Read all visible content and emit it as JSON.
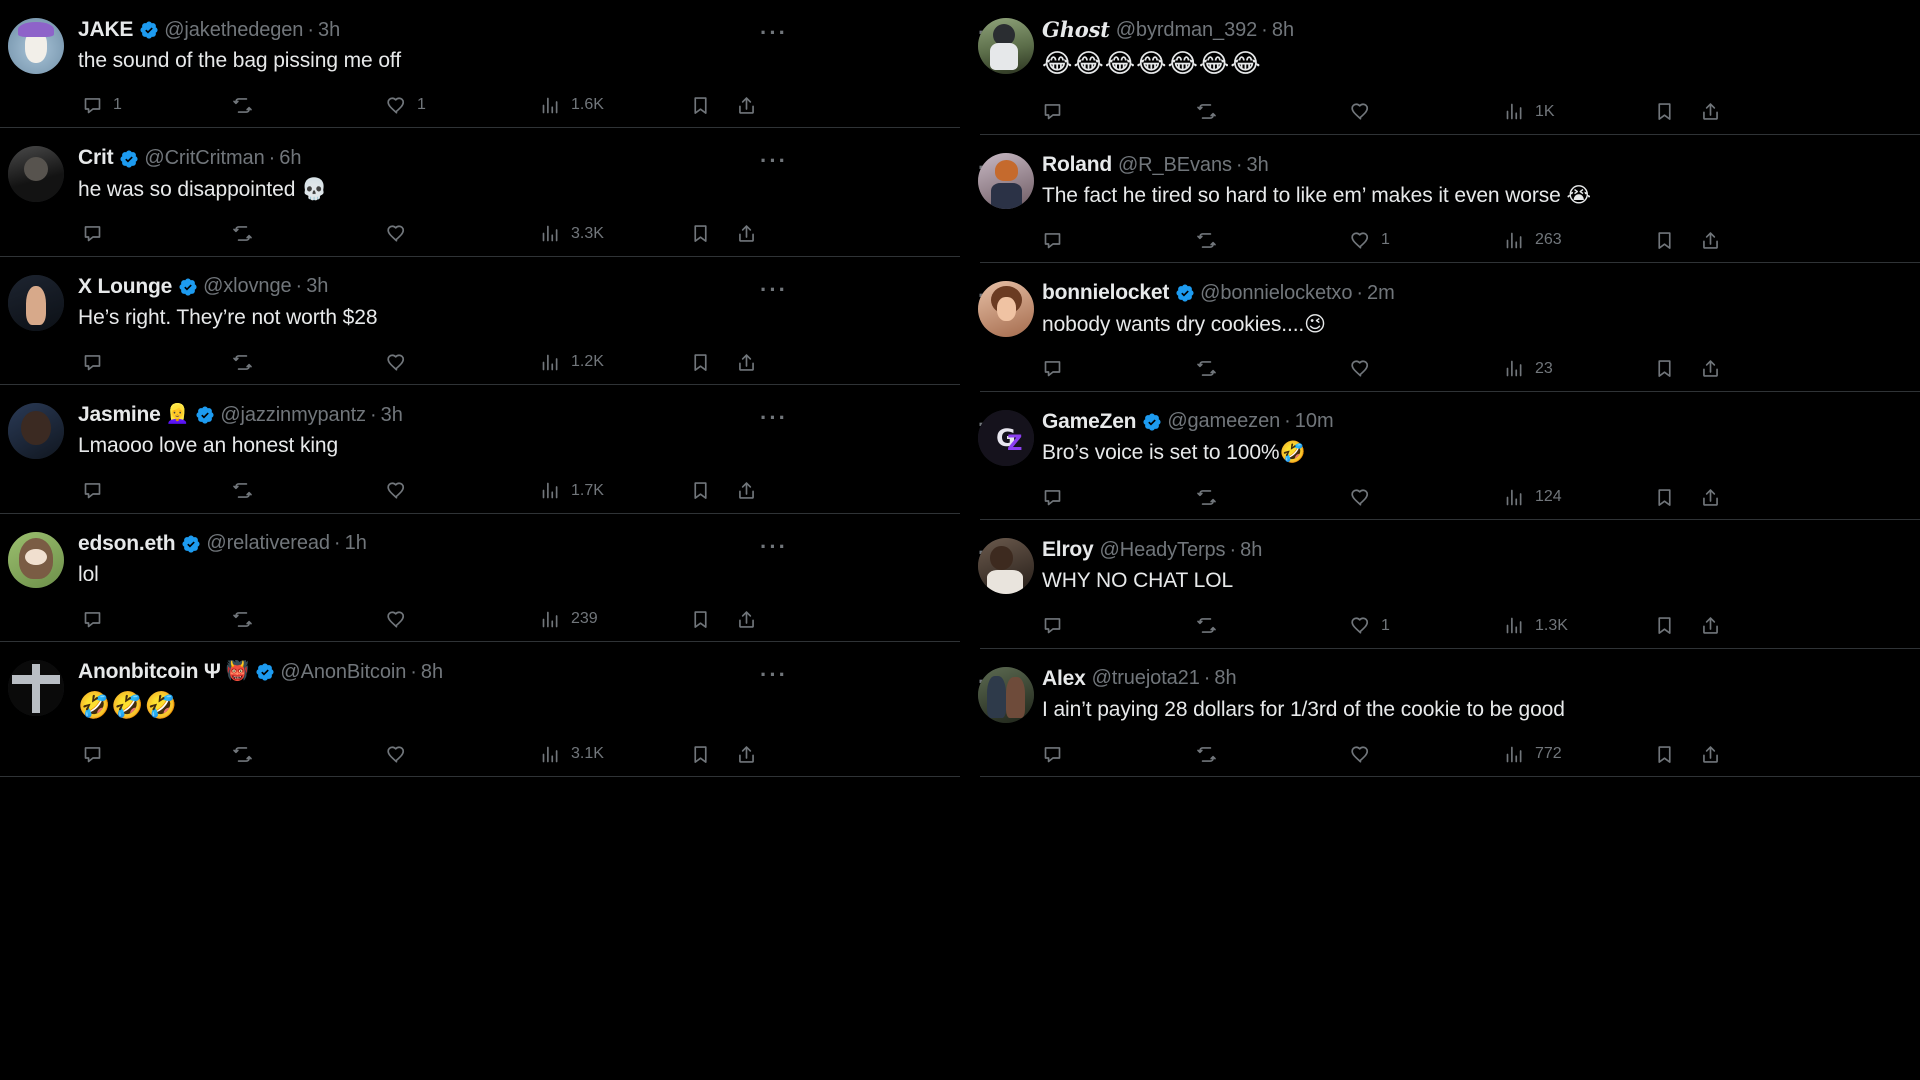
{
  "theme": {
    "background": "#000000",
    "text_primary": "#e7e9ea",
    "text_secondary": "#71767b",
    "divider": "#2f3336",
    "verified_blue": "#1d9bf0"
  },
  "icons": {
    "reply": "reply-icon",
    "retweet": "retweet-icon",
    "like": "heart-icon",
    "views": "views-bar-chart-icon",
    "bookmark": "bookmark-icon",
    "share": "share-icon",
    "more": "more-options-icon",
    "verified": "verified-badge-icon"
  },
  "more_label": "···",
  "columns": [
    {
      "id": "left-column",
      "tweets": [
        {
          "avatar": "av-jake",
          "display_name": "JAKE",
          "name_emoji": "",
          "verified": true,
          "handle": "@jakethedegen",
          "separator": "·",
          "time": "3h",
          "text": "the sound of the bag pissing me off",
          "emoji_only": false,
          "replies": "1",
          "retweets": "",
          "likes": "1",
          "views": "1.6K"
        },
        {
          "avatar": "av-crit",
          "display_name": "Crit",
          "name_emoji": "",
          "verified": true,
          "handle": "@CritCritman",
          "separator": "·",
          "time": "6h",
          "text": "he was so disappointed 💀",
          "emoji_only": false,
          "replies": "",
          "retweets": "",
          "likes": "",
          "views": "3.3K"
        },
        {
          "avatar": "av-xlounge",
          "display_name": "X Lounge",
          "name_emoji": "",
          "verified": true,
          "handle": "@xlovnge",
          "separator": "·",
          "time": "3h",
          "text": "He’s right. They’re not worth $28",
          "emoji_only": false,
          "replies": "",
          "retweets": "",
          "likes": "",
          "views": "1.2K"
        },
        {
          "avatar": "av-jasmine",
          "display_name": "Jasmine",
          "name_emoji": "👱‍♀️",
          "verified": true,
          "handle": "@jazzinmypantz",
          "separator": "·",
          "time": "3h",
          "text": "Lmaooo love an honest king",
          "emoji_only": false,
          "replies": "",
          "retweets": "",
          "likes": "",
          "views": "1.7K"
        },
        {
          "avatar": "av-edson",
          "display_name": "edson.eth",
          "name_emoji": "",
          "verified": true,
          "handle": "@relativeread",
          "separator": "·",
          "time": "1h",
          "text": "lol",
          "emoji_only": false,
          "replies": "",
          "retweets": "",
          "likes": "",
          "views": "239"
        },
        {
          "avatar": "av-anon",
          "display_name": "Anonbitcoin Ψ",
          "name_emoji": "👹",
          "verified": true,
          "handle": "@AnonBitcoin",
          "separator": "·",
          "time": "8h",
          "text": "🤣🤣🤣",
          "emoji_only": true,
          "replies": "",
          "retweets": "",
          "likes": "",
          "views": "3.1K"
        }
      ]
    },
    {
      "id": "right-column",
      "tweets": [
        {
          "avatar": "av-ghost",
          "display_name": "Ghost",
          "script_font": true,
          "name_emoji": "",
          "verified": false,
          "handle": "@byrdman_392",
          "separator": "·",
          "time": "8h",
          "text": "😂😂😂😂😂😂😂",
          "emoji_only": true,
          "replies": "",
          "retweets": "",
          "likes": "",
          "views": "1K"
        },
        {
          "avatar": "av-roland",
          "display_name": "Roland",
          "name_emoji": "",
          "verified": false,
          "handle": "@R_BEvans",
          "separator": "·",
          "time": "3h",
          "text": "The fact he tired so hard to like em’ makes it even worse 😭",
          "emoji_only": false,
          "replies": "",
          "retweets": "",
          "likes": "1",
          "views": "263"
        },
        {
          "avatar": "av-bonnie",
          "display_name": "bonnielocket",
          "name_emoji": "",
          "verified": true,
          "handle": "@bonnielocketxo",
          "separator": "·",
          "time": "2m",
          "text": "nobody wants dry cookies....😉",
          "emoji_only": false,
          "replies": "",
          "retweets": "",
          "likes": "",
          "views": "23"
        },
        {
          "avatar": "av-gamezen",
          "display_name": "GameZen",
          "name_emoji": "",
          "verified": true,
          "handle": "@gameezen",
          "separator": "·",
          "time": "10m",
          "text": "Bro’s voice is set to 100%🤣",
          "emoji_only": false,
          "replies": "",
          "retweets": "",
          "likes": "",
          "views": "124"
        },
        {
          "avatar": "av-elroy",
          "display_name": "Elroy",
          "name_emoji": "",
          "verified": false,
          "handle": "@HeadyTerps",
          "separator": "·",
          "time": "8h",
          "text": "WHY NO CHAT LOL",
          "emoji_only": false,
          "replies": "",
          "retweets": "",
          "likes": "1",
          "views": "1.3K"
        },
        {
          "avatar": "av-alex",
          "display_name": "Alex",
          "name_emoji": "",
          "verified": false,
          "handle": "@truejota21",
          "separator": "·",
          "time": "8h",
          "text": "I ain’t paying 28 dollars for 1/3rd of the cookie to be good",
          "emoji_only": false,
          "replies": "",
          "retweets": "",
          "likes": "",
          "views": "772"
        }
      ]
    }
  ]
}
